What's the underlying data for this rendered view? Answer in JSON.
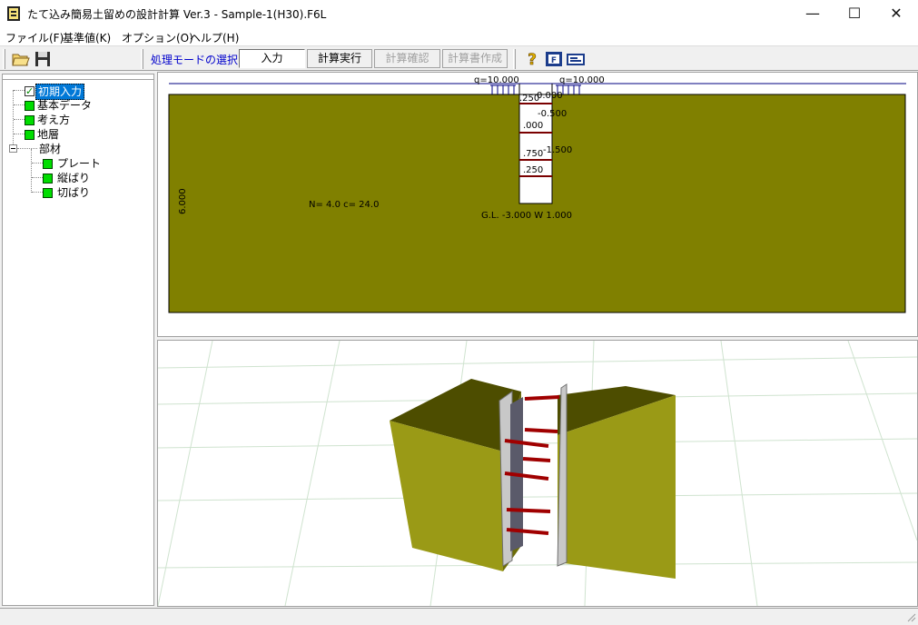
{
  "window": {
    "title": "たて込み簡易土留めの設計計算 Ver.3 - Sample-1(H30).F6L",
    "minimize": "—",
    "maximize": "☐",
    "close": "✕"
  },
  "menu": {
    "items": [
      {
        "label": "ファイル(F)"
      },
      {
        "label": "基準値(K)"
      },
      {
        "label": "オプション(O)"
      },
      {
        "label": "ヘルプ(H)"
      }
    ]
  },
  "toolbar": {
    "mode_label": "処理モードの選択",
    "input_label": "入力",
    "run_label": "計算実行",
    "confirm_label": "計算確認",
    "report_label": "計算書作成",
    "icons": {
      "open": "folder-open-icon",
      "save": "floppy-disk-icon",
      "help": "question-mark-icon",
      "about": "about-icon",
      "export": "export-icon"
    }
  },
  "tree": {
    "root_items": [
      {
        "label": "初期入力",
        "checked": true
      },
      {
        "label": "基本データ"
      },
      {
        "label": "考え方"
      },
      {
        "label": "地層"
      },
      {
        "label": "部材"
      }
    ],
    "child_items": [
      {
        "label": "プレート"
      },
      {
        "label": "縦ばり"
      },
      {
        "label": "切ばり"
      }
    ]
  },
  "drawing": {
    "load_left": "q=10.000",
    "load_right": "q=10.000",
    "dim_top": "0.000",
    "dim_a": ".250",
    "dim_b": "-0.500",
    "dim_c": ".000",
    "dim_d": "-1.500",
    "dim_e": ".750",
    "dim_f": ".250",
    "depth_label": "6.000",
    "soil_params": "N= 4.0 c=  24.0",
    "gl_label": "G.L. -3.000 W 1.000",
    "soil_color": "#808000"
  }
}
